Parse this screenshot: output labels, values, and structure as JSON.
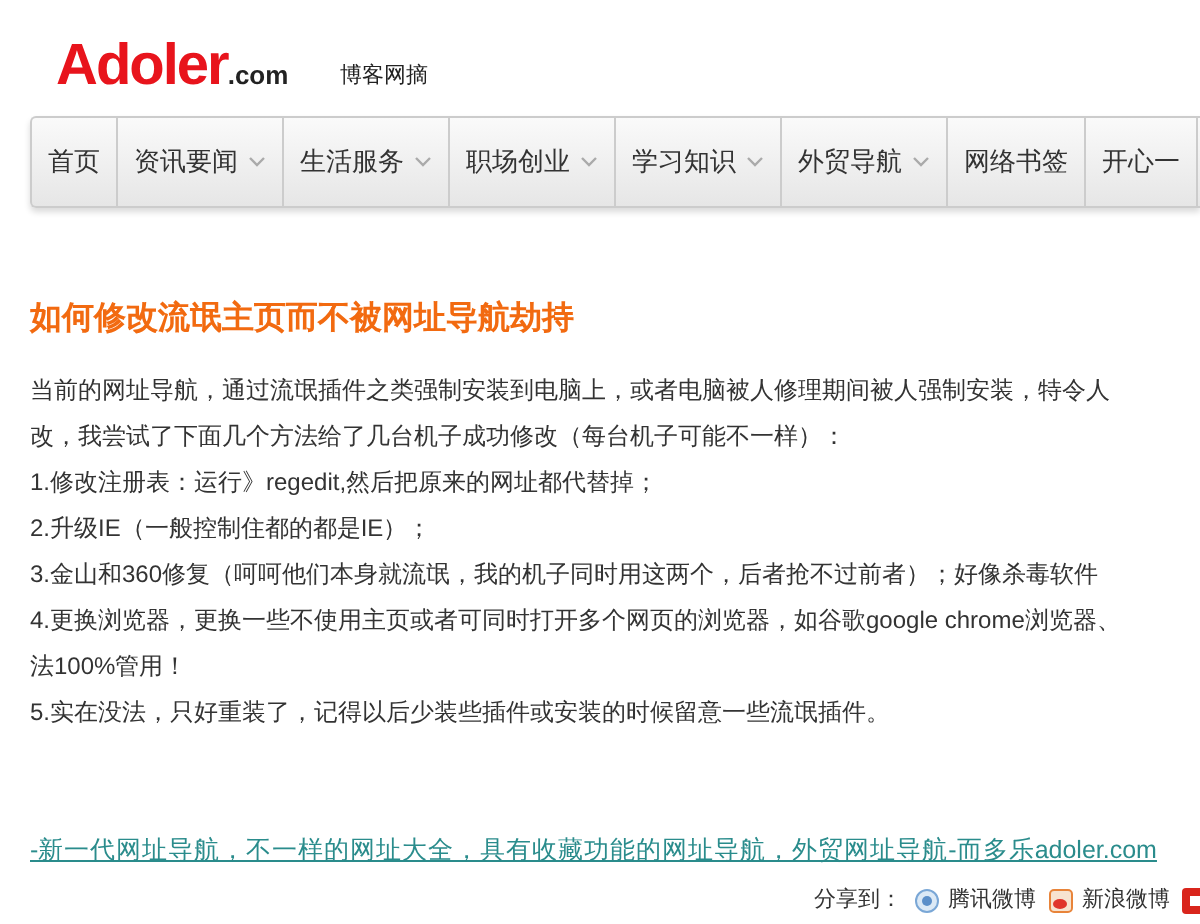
{
  "logo": {
    "brand": "Adoler",
    "domain": ".com",
    "tagline": "博客网摘"
  },
  "nav": [
    {
      "label": "首页",
      "dropdown": false
    },
    {
      "label": "资讯要闻",
      "dropdown": true
    },
    {
      "label": "生活服务",
      "dropdown": true
    },
    {
      "label": "职场创业",
      "dropdown": true
    },
    {
      "label": "学习知识",
      "dropdown": true
    },
    {
      "label": "外贸导航",
      "dropdown": true
    },
    {
      "label": "网络书签",
      "dropdown": false
    },
    {
      "label": "开心一",
      "dropdown": false
    }
  ],
  "article": {
    "title": "如何修改流氓主页而不被网址导航劫持",
    "lines": [
      "当前的网址导航，通过流氓插件之类强制安装到电脑上，或者电脑被人修理期间被人强制安装，特令人",
      "改，我尝试了下面几个方法给了几台机子成功修改（每台机子可能不一样）：",
      "1.修改注册表：运行》regedit,然后把原来的网址都代替掉；",
      "2.升级IE（一般控制住都的都是IE）；",
      "3.金山和360修复（呵呵他们本身就流氓，我的机子同时用这两个，后者抢不过前者）；好像杀毒软件",
      "4.更换浏览器，更换一些不使用主页或者可同时打开多个网页的浏览器，如谷歌google chrome浏览器、",
      "法100%管用！",
      "5.实在没法，只好重装了，记得以后少装些插件或安装的时候留意一些流氓插件。"
    ]
  },
  "footer_link": "-新一代网址导航，不一样的网址大全，具有收藏功能的网址导航，外贸网址导航-而多乐adoler.com",
  "share": {
    "label": "分享到：",
    "items": [
      {
        "label": "腾讯微博",
        "kind": "tencent"
      },
      {
        "label": "新浪微博",
        "kind": "sina"
      },
      {
        "kind": "other"
      }
    ]
  }
}
